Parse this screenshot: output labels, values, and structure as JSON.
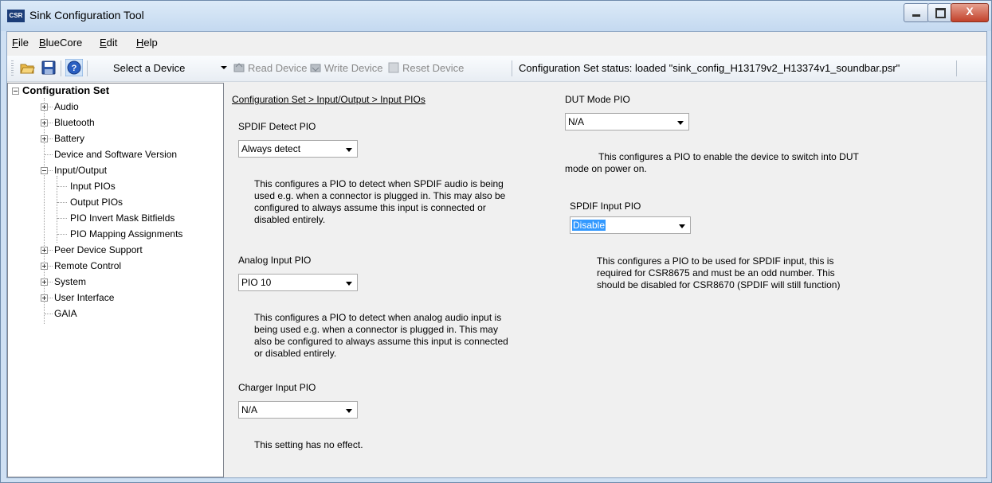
{
  "window": {
    "app_icon_text": "CSR",
    "title": "Sink Configuration Tool",
    "close_symbol": "X"
  },
  "menu": {
    "items": [
      "File",
      "BlueCore",
      "Edit",
      "Help"
    ],
    "underline": [
      "F",
      "B",
      "E",
      "H"
    ],
    "rest": [
      "ile",
      "lueCore",
      "dit",
      "elp"
    ]
  },
  "toolbar": {
    "icons": [
      "open-folder-icon",
      "save-icon",
      "help-icon"
    ],
    "device_select": "Select a Device",
    "read_device": "Read Device",
    "write_device": "Write Device",
    "reset_device": "Reset Device",
    "status": "Configuration Set status:  loaded \"sink_config_H13179v2_H13374v1_soundbar.psr\""
  },
  "tree": {
    "root": "Configuration Set",
    "items": [
      {
        "label": "Audio",
        "expander": "plus"
      },
      {
        "label": "Bluetooth",
        "expander": "plus"
      },
      {
        "label": "Battery",
        "expander": "plus"
      },
      {
        "label": "Device and Software Version",
        "expander": "none"
      },
      {
        "label": "Input/Output",
        "expander": "minus"
      },
      {
        "label": "Input PIOs",
        "expander": "child"
      },
      {
        "label": "Output PIOs",
        "expander": "child"
      },
      {
        "label": "PIO Invert Mask Bitfields",
        "expander": "child"
      },
      {
        "label": "PIO Mapping Assignments",
        "expander": "child"
      },
      {
        "label": "Peer Device Support",
        "expander": "plus"
      },
      {
        "label": "Remote Control",
        "expander": "plus"
      },
      {
        "label": "System",
        "expander": "plus"
      },
      {
        "label": "User Interface",
        "expander": "plus"
      },
      {
        "label": "GAIA",
        "expander": "none"
      }
    ]
  },
  "content": {
    "breadcrumb": "Configuration Set > Input/Output > Input PIOs",
    "spdif_detect": {
      "label": "SPDIF Detect PIO",
      "value": "Always detect",
      "desc": [
        "This configures a PIO to detect when SPDIF audio is being",
        "used e.g. when a connector is plugged in.  This may also be",
        "configured to always assume this input is connected or",
        "disabled entirely."
      ]
    },
    "analog_input": {
      "label": "Analog Input PIO",
      "value": "PIO 10",
      "desc": [
        "This configures a PIO to detect when analog audio input is",
        "being used e.g. when a connector is plugged in.    This may",
        "also be configured to always assume this input is connected",
        "or disabled entirely."
      ]
    },
    "charger_input": {
      "label": "Charger Input PIO",
      "value": "N/A",
      "desc": [
        "This setting has no effect."
      ]
    },
    "dut_mode": {
      "label": "DUT Mode PIO",
      "value": "N/A",
      "desc": [
        "This configures a PIO to enable the device to switch into DUT",
        "mode on power on."
      ]
    },
    "spdif_input": {
      "label": "SPDIF Input PIO",
      "value": "Disable",
      "desc": [
        "This configures a PIO to be used for SPDIF input, this is",
        "required for CSR8675 and must be an odd number. This",
        "should be disabled for CSR8670 (SPDIF will still function)"
      ]
    }
  }
}
